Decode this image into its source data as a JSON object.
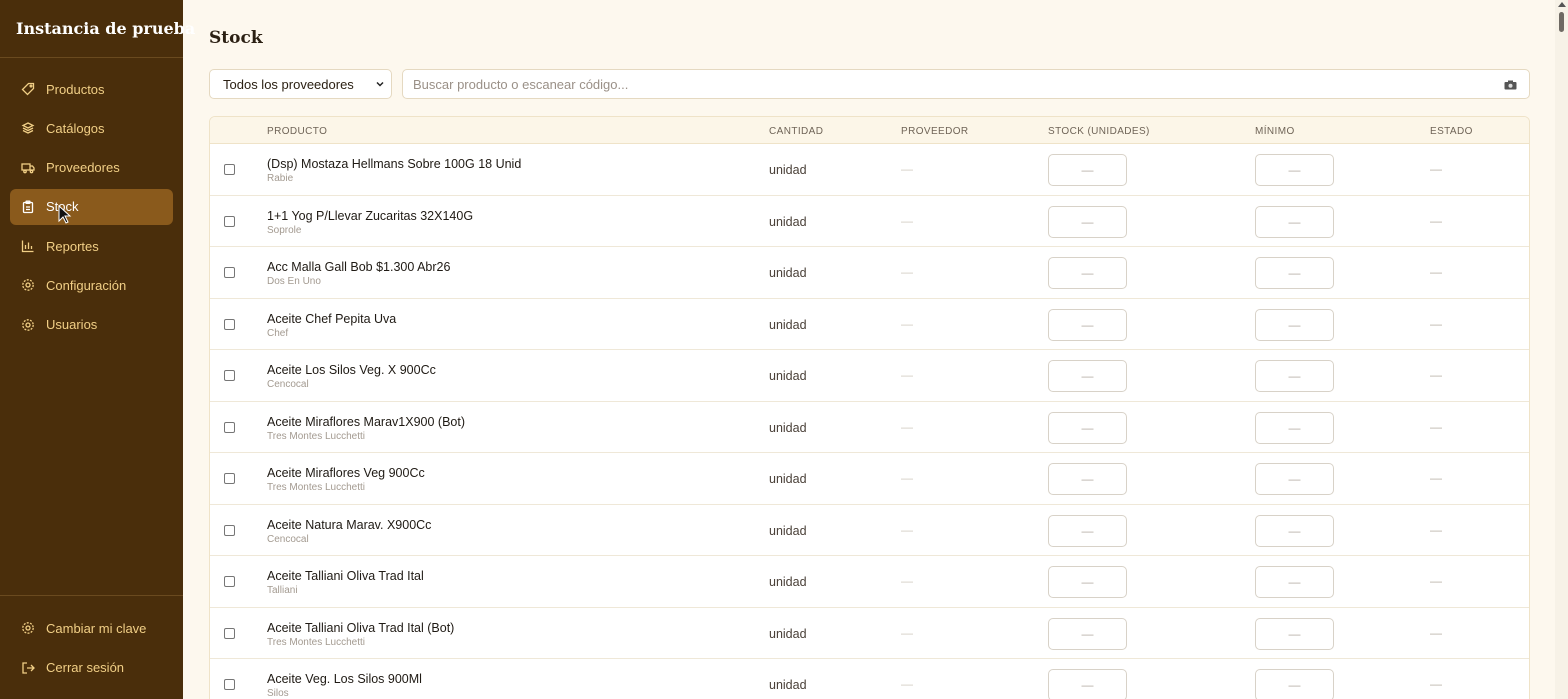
{
  "app": {
    "instance_name": "Instancia de prueba"
  },
  "sidebar": {
    "items": [
      {
        "label": "Productos",
        "icon": "tag-icon"
      },
      {
        "label": "Catálogos",
        "icon": "layers-icon"
      },
      {
        "label": "Proveedores",
        "icon": "truck-icon"
      },
      {
        "label": "Stock",
        "icon": "clipboard-icon",
        "active": true
      },
      {
        "label": "Reportes",
        "icon": "bar-chart-icon"
      },
      {
        "label": "Configuración",
        "icon": "gear-icon"
      },
      {
        "label": "Usuarios",
        "icon": "gear-icon"
      }
    ],
    "bottom": [
      {
        "label": "Cambiar mi clave",
        "icon": "gear-icon"
      },
      {
        "label": "Cerrar sesión",
        "icon": "logout-icon"
      }
    ]
  },
  "page": {
    "title": "Stock",
    "supplier_filter": "Todos los proveedores",
    "search_placeholder": "Buscar producto o escanear código..."
  },
  "table": {
    "columns": {
      "producto": "PRODUCTO",
      "cantidad": "CANTIDAD",
      "proveedor": "PROVEEDOR",
      "stock": "STOCK (UNIDADES)",
      "minimo": "MÍNIMO",
      "estado": "ESTADO"
    },
    "rows": [
      {
        "name": "(Dsp) Mostaza Hellmans Sobre 100G 18 Unid",
        "brand": "Rabie",
        "unit": "unidad",
        "provider": "—",
        "stock": "—",
        "min": "—",
        "status": "—"
      },
      {
        "name": "1+1 Yog P/Llevar Zucaritas 32X140G",
        "brand": "Soprole",
        "unit": "unidad",
        "provider": "—",
        "stock": "—",
        "min": "—",
        "status": "—"
      },
      {
        "name": "Acc Malla Gall Bob $1.300 Abr26",
        "brand": "Dos En Uno",
        "unit": "unidad",
        "provider": "—",
        "stock": "—",
        "min": "—",
        "status": "—"
      },
      {
        "name": "Aceite Chef Pepita Uva",
        "brand": "Chef",
        "unit": "unidad",
        "provider": "—",
        "stock": "—",
        "min": "—",
        "status": "—"
      },
      {
        "name": "Aceite Los Silos Veg. X 900Cc",
        "brand": "Cencocal",
        "unit": "unidad",
        "provider": "—",
        "stock": "—",
        "min": "—",
        "status": "—"
      },
      {
        "name": "Aceite Miraflores Marav1X900 (Bot)",
        "brand": "Tres Montes Lucchetti",
        "unit": "unidad",
        "provider": "—",
        "stock": "—",
        "min": "—",
        "status": "—"
      },
      {
        "name": "Aceite Miraflores Veg 900Cc",
        "brand": "Tres Montes Lucchetti",
        "unit": "unidad",
        "provider": "—",
        "stock": "—",
        "min": "—",
        "status": "—"
      },
      {
        "name": "Aceite Natura Marav. X900Cc",
        "brand": "Cencocal",
        "unit": "unidad",
        "provider": "—",
        "stock": "—",
        "min": "—",
        "status": "—"
      },
      {
        "name": "Aceite Talliani Oliva Trad Ital",
        "brand": "Talliani",
        "unit": "unidad",
        "provider": "—",
        "stock": "—",
        "min": "—",
        "status": "—"
      },
      {
        "name": "Aceite Talliani Oliva Trad Ital (Bot)",
        "brand": "Tres Montes Lucchetti",
        "unit": "unidad",
        "provider": "—",
        "stock": "—",
        "min": "—",
        "status": "—"
      },
      {
        "name": "Aceite Veg. Los Silos 900Ml",
        "brand": "Silos",
        "unit": "unidad",
        "provider": "—",
        "stock": "—",
        "min": "—",
        "status": "—"
      }
    ]
  }
}
